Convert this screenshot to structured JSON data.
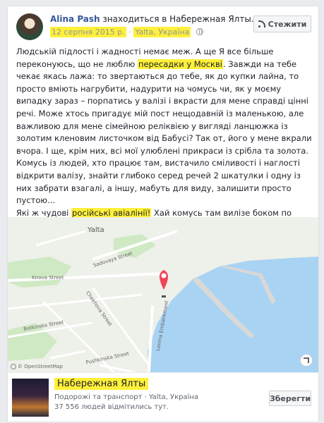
{
  "post": {
    "author": "Alina Pash",
    "location_text": "знаходиться в Набережная Ялты.",
    "date": "12 серпня 2015 р.",
    "place_meta": "Yalta, Україна",
    "follow_label": "Стежити",
    "body": {
      "p1_a": "Людській підлості і жадності немає меж. А ще Я все більше переконуюсь, що не люблю ",
      "p1_hl": "пересадки у Москві",
      "p1_b": ". Завжди на тебе чекає якась лажа: то звертаються до тебе, як до купки лайна, то просто вміють нагрубити, надурити на чомусь чи, як у моєму випадку зараз – порпатись у валізі і вкрасти для мене справді цінні речі. Може хтось пригадує мій пост нещодавній із маленькою, але важливою для мене сімейною реліквією у вигляді ланцюжка із золотим кленовим листочком від Бабусі? Так от, його у мене вкрали вчора. І ще, крім них, всі мої улюблені прикраси із срібла та золота. Комусь із людей, хто працює там, вистачило сміливості і наглості відкрити валізу, знайти глибоко серед речей 2 шкатулки і одну із них забрати взагалі, а іншу, мабуть для виду, залишити просто пустою...",
      "p2_a": "Які ж чудові ",
      "p2_hl": "російські авіалінії!",
      "p2_b": " Хай комусь там вилізе боком по найбільшому максимуму у Всесвіті і стане поперек горла."
    }
  },
  "map": {
    "city": "Yalta",
    "streets": {
      "sadovaya": "Sadovaya Street",
      "kirova": "Kirova Street",
      "chekhova": "Chekhova Street",
      "botkinska": "Botkinska Street",
      "pushkinska": "Pushkinska Street",
      "lenina": "Lenina Embankment"
    },
    "attribution": "© OpenStreetMap",
    "colors": {
      "water": "#a9d3f3",
      "land": "#eef0ea",
      "park": "#cfe9c4",
      "pin": "#f0445a"
    }
  },
  "place": {
    "name": "Набережная Ялты",
    "category": "Подорожі та транспорт · Yalta, Україна",
    "visits": "37 556 людей відмітились тут.",
    "save_label": "Зберегти"
  },
  "highlight_color": "#fff03a"
}
